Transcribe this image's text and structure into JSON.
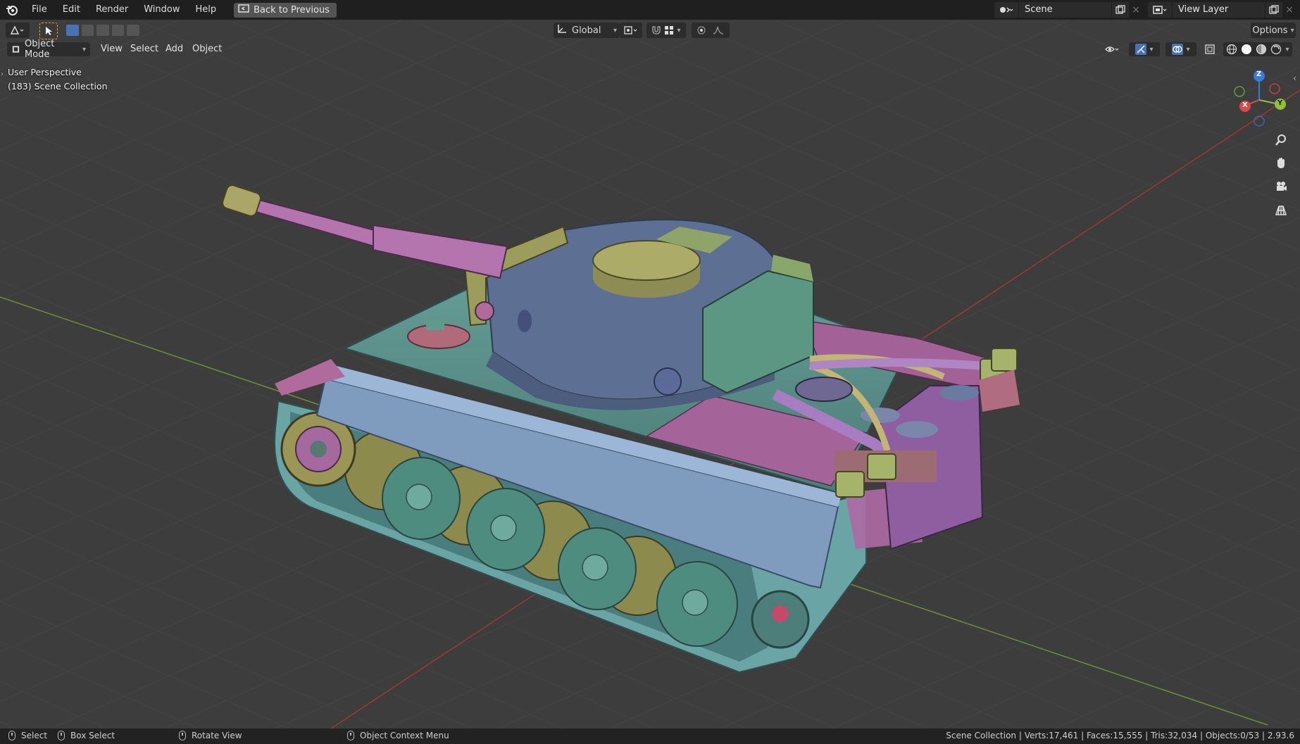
{
  "menubar": {
    "items": [
      "File",
      "Edit",
      "Render",
      "Window",
      "Help"
    ],
    "back_button": "Back to Previous",
    "scene": "Scene",
    "view_layer": "View Layer"
  },
  "toolbar": {
    "transform_orientation": "Global",
    "options_label": "Options"
  },
  "viewport_header": {
    "mode": "Object Mode",
    "menus": [
      "View",
      "Select",
      "Add",
      "Object"
    ]
  },
  "overlay": {
    "view_name": "User Perspective",
    "collection": "(183) Scene Collection"
  },
  "gizmo": {
    "x": "X",
    "y": "Y",
    "z": "Z"
  },
  "statusbar": {
    "select": "Select",
    "box_select": "Box Select",
    "rotate_view": "Rotate View",
    "context_menu": "Object Context Menu",
    "stats": "Scene Collection | Verts:17,461 | Faces:15,555 | Tris:32,034 | Objects:0/53 | 2.93.6"
  },
  "colors": {
    "hull": "#5e8f8a",
    "turret": "#5d6f93",
    "pink": "#b56aa6",
    "olive": "#a8a461",
    "wheel": "#4f8c80"
  }
}
